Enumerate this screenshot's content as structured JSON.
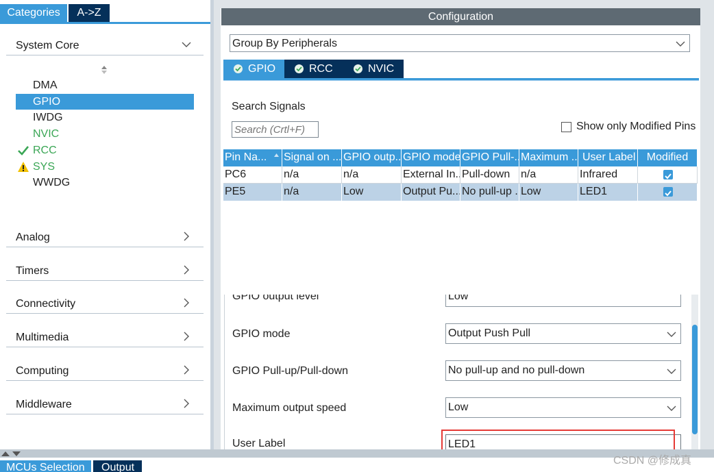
{
  "left": {
    "tabs": [
      "Categories",
      "A->Z"
    ],
    "system_core": {
      "label": "System Core",
      "items": [
        {
          "label": "DMA",
          "status": ""
        },
        {
          "label": "GPIO",
          "status": "selected"
        },
        {
          "label": "IWDG",
          "status": ""
        },
        {
          "label": "NVIC",
          "status": "enabled"
        },
        {
          "label": "RCC",
          "status": "check"
        },
        {
          "label": "SYS",
          "status": "warning"
        },
        {
          "label": "WWDG",
          "status": ""
        }
      ]
    },
    "categories": [
      "Analog",
      "Timers",
      "Connectivity",
      "Multimedia",
      "Computing",
      "Middleware"
    ]
  },
  "config": {
    "title": "Configuration",
    "group_select": "Group By Peripherals",
    "tabs": [
      "GPIO",
      "RCC",
      "NVIC"
    ],
    "search_label": "Search Signals",
    "search_placeholder": "Search (Crtl+F)",
    "show_modified": "Show only Modified Pins",
    "table": {
      "headers": [
        "Pin Na...",
        "Signal on ...",
        "GPIO outp...",
        "GPIO mode",
        "GPIO Pull-...",
        "Maximum ...",
        "User Label",
        "Modified"
      ],
      "rows": [
        [
          "PC6",
          "n/a",
          "n/a",
          "External In...",
          "Pull-down",
          "n/a",
          "Infrared",
          true
        ],
        [
          "PE5",
          "n/a",
          "Low",
          "Output Pu...",
          "No pull-up ...",
          "Low",
          "LED1",
          true
        ]
      ]
    },
    "properties": [
      {
        "label": "GPIO output level",
        "value": "Low"
      },
      {
        "label": "GPIO mode",
        "value": "Output Push Pull"
      },
      {
        "label": "GPIO Pull-up/Pull-down",
        "value": "No pull-up and no pull-down"
      },
      {
        "label": "Maximum output speed",
        "value": "Low"
      },
      {
        "label": "User Label",
        "value": "LED1"
      }
    ]
  },
  "bottom_tabs": [
    "MCUs Selection",
    "Output"
  ],
  "watermark": "CSDN @修成真",
  "colors": {
    "accent": "#3a9ad9",
    "dark_tab": "#05305a",
    "header_bar": "#5e6a73",
    "selected_row": "#bcd2e6",
    "highlight": "#e53935",
    "green": "#3aa655"
  }
}
